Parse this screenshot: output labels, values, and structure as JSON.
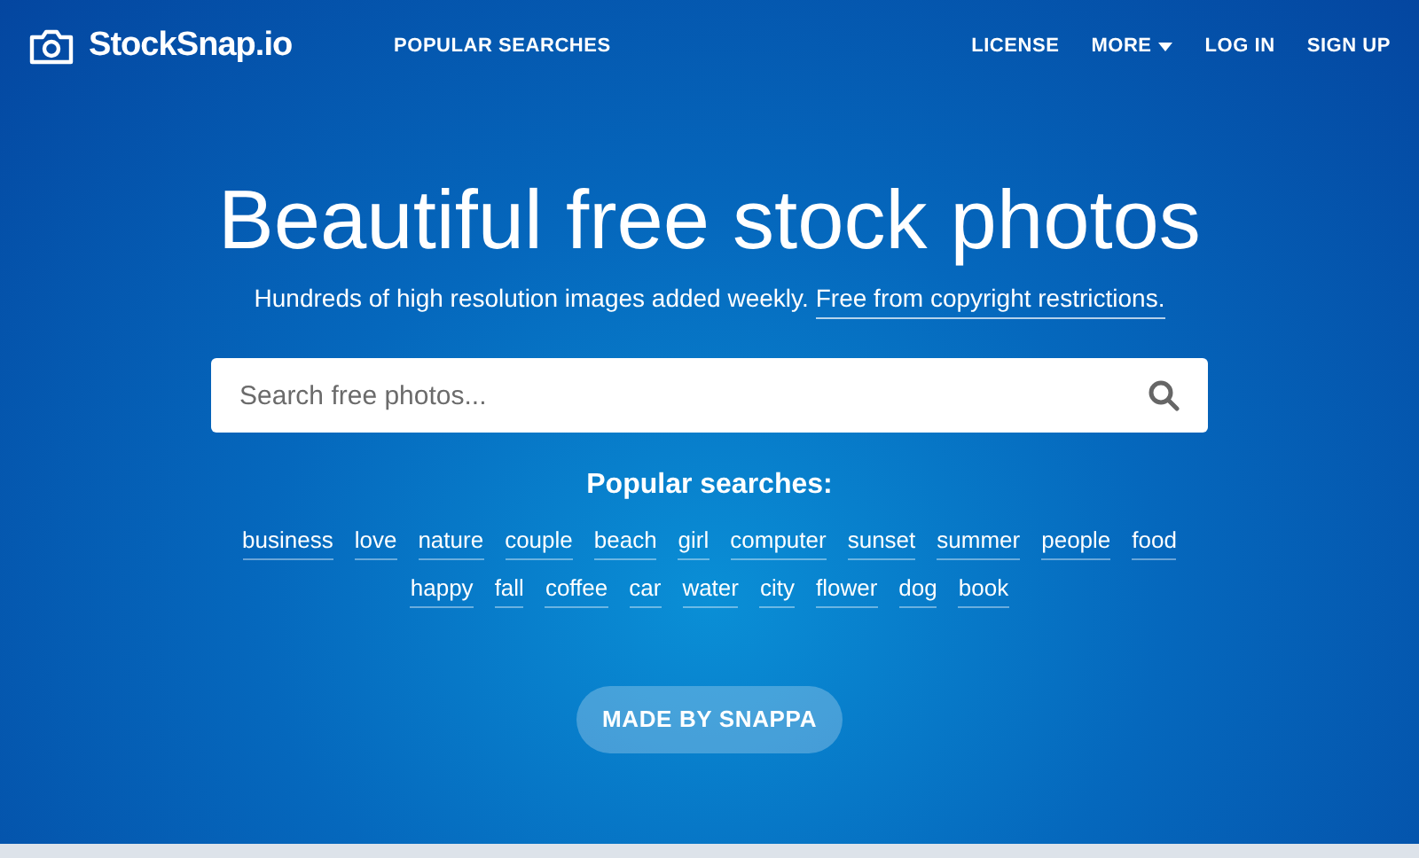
{
  "header": {
    "logo": "StockSnap.io",
    "nav_left": "POPULAR SEARCHES",
    "nav_right": [
      {
        "label": "LICENSE",
        "dropdown": false
      },
      {
        "label": "MORE",
        "dropdown": true
      },
      {
        "label": "LOG IN",
        "dropdown": false
      },
      {
        "label": "SIGN UP",
        "dropdown": false
      }
    ]
  },
  "hero": {
    "title": "Beautiful free stock photos",
    "subtitle": "Hundreds of high resolution images added weekly.",
    "subtitle_link": "Free from copyright restrictions.",
    "search": {
      "placeholder": "Search free photos..."
    },
    "popular_title": "Popular searches:",
    "tag_rows": [
      [
        "business",
        "love",
        "nature",
        "couple",
        "beach",
        "girl",
        "computer",
        "sunset",
        "summer",
        "people",
        "food"
      ],
      [
        "happy",
        "fall",
        "coffee",
        "car",
        "water",
        "city",
        "flower",
        "dog",
        "book"
      ]
    ],
    "button": "MADE BY SNAPPA"
  }
}
